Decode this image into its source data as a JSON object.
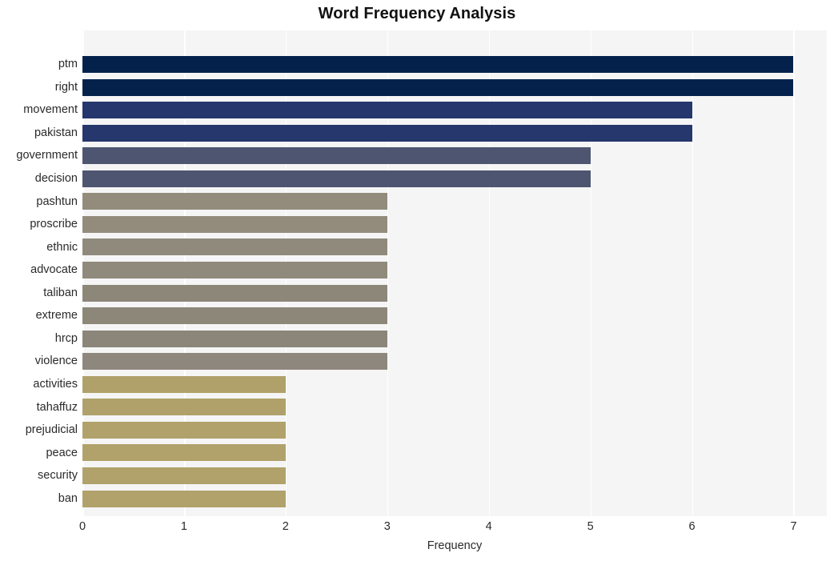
{
  "chart_data": {
    "type": "bar",
    "orientation": "horizontal",
    "title": "Word Frequency Analysis",
    "xlabel": "Frequency",
    "ylabel": "",
    "xlim": [
      0,
      7.327
    ],
    "xticks": [
      0,
      1,
      2,
      3,
      4,
      5,
      6,
      7
    ],
    "xtick_labels": [
      "0",
      "1",
      "2",
      "3",
      "4",
      "5",
      "6",
      "7"
    ],
    "grid": true,
    "grid_axis": "x",
    "grid_color": "#ffffff",
    "plot_background": "#f5f5f6",
    "figure_background": "#ffffff",
    "legend": null,
    "categories": [
      "ptm",
      "right",
      "movement",
      "pakistan",
      "government",
      "decision",
      "pashtun",
      "proscribe",
      "ethnic",
      "advocate",
      "taliban",
      "extreme",
      "hrcp",
      "violence",
      "activities",
      "tahaffuz",
      "prejudicial",
      "peace",
      "security",
      "ban"
    ],
    "values": [
      7,
      7,
      6,
      6,
      5,
      5,
      3,
      3,
      3,
      3,
      3,
      3,
      3,
      3,
      2,
      2,
      2,
      2,
      2,
      2
    ],
    "bar_colors": [
      "#04214c",
      "#04214c",
      "#25376c",
      "#25376c",
      "#4e5570",
      "#4e5570",
      "#938c7d",
      "#938c7d",
      "#8f8a7c",
      "#8f8a7c",
      "#8c8779",
      "#8c8779",
      "#8b8679",
      "#8e877d",
      "#afa169",
      "#afa169",
      "#b0a26a",
      "#b0a26a",
      "#b0a26a",
      "#b0a26a"
    ],
    "bars": [
      {
        "label": "ptm",
        "value": 7,
        "color": "#04214c"
      },
      {
        "label": "right",
        "value": 7,
        "color": "#04214c"
      },
      {
        "label": "movement",
        "value": 6,
        "color": "#25376c"
      },
      {
        "label": "pakistan",
        "value": 6,
        "color": "#25376c"
      },
      {
        "label": "government",
        "value": 5,
        "color": "#4e5570"
      },
      {
        "label": "decision",
        "value": 5,
        "color": "#4e5570"
      },
      {
        "label": "pashtun",
        "value": 3,
        "color": "#938c7d"
      },
      {
        "label": "proscribe",
        "value": 3,
        "color": "#938c7d"
      },
      {
        "label": "ethnic",
        "value": 3,
        "color": "#8f8a7c"
      },
      {
        "label": "advocate",
        "value": 3,
        "color": "#8f8a7c"
      },
      {
        "label": "taliban",
        "value": 3,
        "color": "#8c8779"
      },
      {
        "label": "extreme",
        "value": 3,
        "color": "#8c8779"
      },
      {
        "label": "hrcp",
        "value": 3,
        "color": "#8b8679"
      },
      {
        "label": "violence",
        "value": 3,
        "color": "#8e877d"
      },
      {
        "label": "activities",
        "value": 2,
        "color": "#afa169"
      },
      {
        "label": "tahaffuz",
        "value": 2,
        "color": "#afa169"
      },
      {
        "label": "prejudicial",
        "value": 2,
        "color": "#b0a26a"
      },
      {
        "label": "peace",
        "value": 2,
        "color": "#b0a26a"
      },
      {
        "label": "security",
        "value": 2,
        "color": "#b0a26a"
      },
      {
        "label": "ban",
        "value": 2,
        "color": "#b0a26a"
      }
    ]
  }
}
